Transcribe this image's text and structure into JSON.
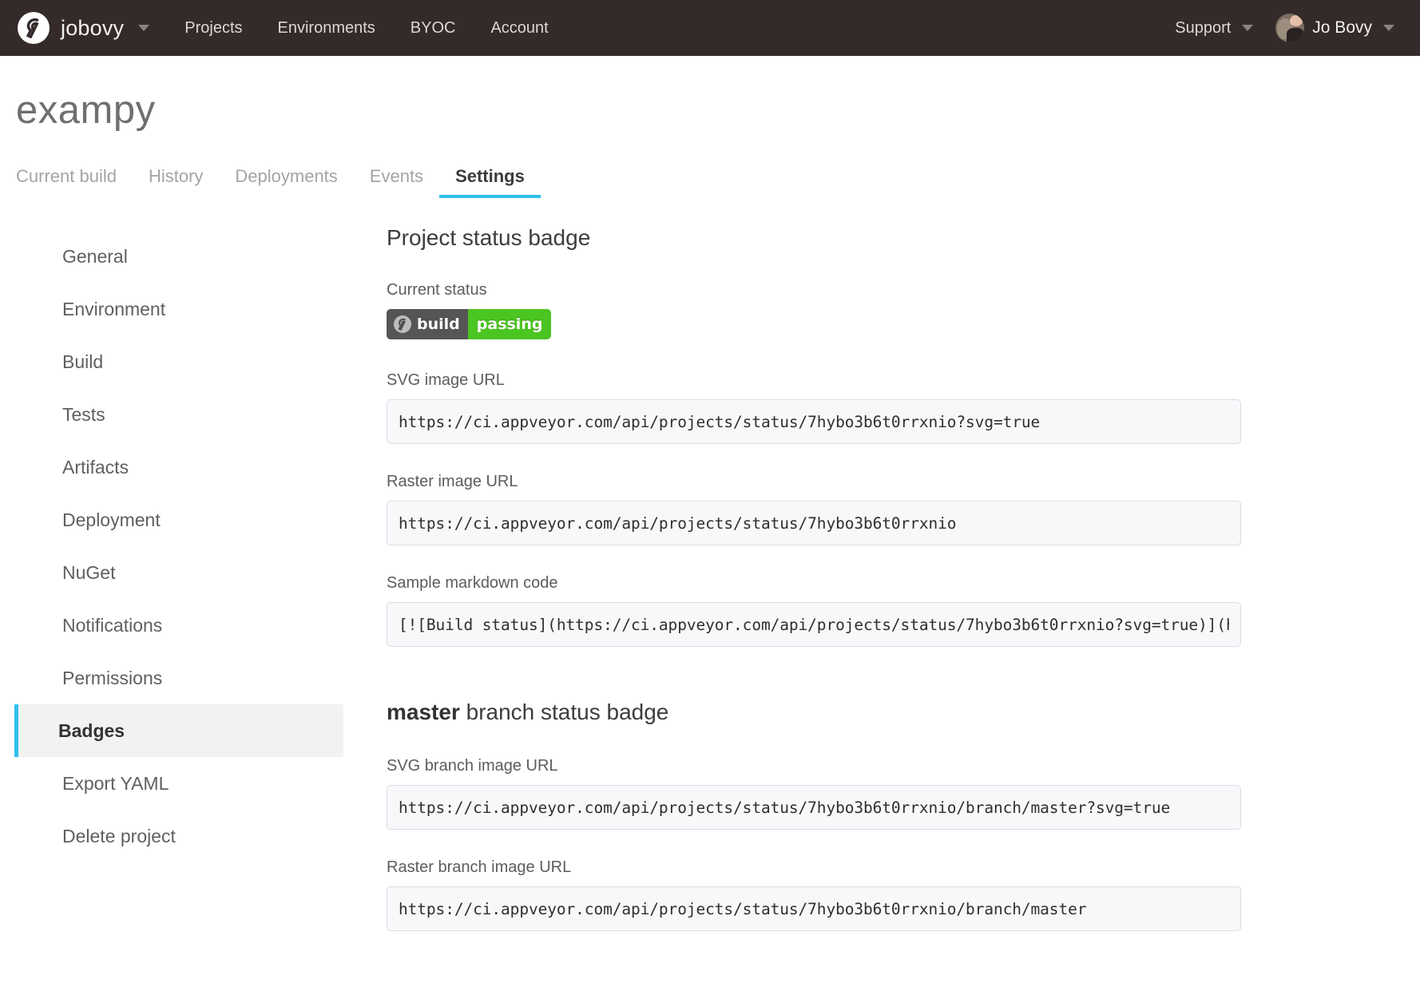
{
  "navbar": {
    "logo_icon": "appveyor-logo-icon",
    "account_name": "jobovy",
    "account_caret_icon": "chevron-down-icon",
    "links": [
      {
        "label": "Projects"
      },
      {
        "label": "Environments"
      },
      {
        "label": "BYOC"
      },
      {
        "label": "Account"
      }
    ],
    "support": {
      "label": "Support",
      "caret_icon": "chevron-down-icon"
    },
    "user": {
      "name": "Jo Bovy",
      "avatar_icon": "user-avatar",
      "caret_icon": "chevron-down-icon"
    },
    "colors": {
      "background": "#332a29",
      "text": "#f2f0ef"
    }
  },
  "page": {
    "project_title": "exampy",
    "tabs": [
      {
        "label": "Current build",
        "active": false
      },
      {
        "label": "History",
        "active": false
      },
      {
        "label": "Deployments",
        "active": false
      },
      {
        "label": "Events",
        "active": false
      },
      {
        "label": "Settings",
        "active": true
      }
    ],
    "accent_color": "#2ec0ee"
  },
  "sidebar": {
    "items": [
      {
        "label": "General",
        "active": false
      },
      {
        "label": "Environment",
        "active": false
      },
      {
        "label": "Build",
        "active": false
      },
      {
        "label": "Tests",
        "active": false
      },
      {
        "label": "Artifacts",
        "active": false
      },
      {
        "label": "Deployment",
        "active": false
      },
      {
        "label": "NuGet",
        "active": false
      },
      {
        "label": "Notifications",
        "active": false
      },
      {
        "label": "Permissions",
        "active": false
      },
      {
        "label": "Badges",
        "active": true
      },
      {
        "label": "Export YAML",
        "active": false
      },
      {
        "label": "Delete project",
        "active": false
      }
    ]
  },
  "main": {
    "project_badge": {
      "heading": "Project status badge",
      "current_status_label": "Current status",
      "badge": {
        "logo_icon": "appveyor-logo-icon",
        "left_text": "build",
        "right_text": "passing",
        "left_color": "#555555",
        "right_color": "#4bc521"
      },
      "fields": [
        {
          "label": "SVG image URL",
          "value": "https://ci.appveyor.com/api/projects/status/7hybo3b6t0rrxnio?svg=true"
        },
        {
          "label": "Raster image URL",
          "value": "https://ci.appveyor.com/api/projects/status/7hybo3b6t0rrxnio"
        },
        {
          "label": "Sample markdown code",
          "value": "[![Build status](https://ci.appveyor.com/api/projects/status/7hybo3b6t0rrxnio?svg=true)](https://ci.appveyor.com/project/jobovy/exampy)"
        }
      ]
    },
    "branch_badge": {
      "heading_bold": "master",
      "heading_rest": " branch status badge",
      "fields": [
        {
          "label": "SVG branch image URL",
          "value": "https://ci.appveyor.com/api/projects/status/7hybo3b6t0rrxnio/branch/master?svg=true"
        },
        {
          "label": "Raster branch image URL",
          "value": "https://ci.appveyor.com/api/projects/status/7hybo3b6t0rrxnio/branch/master"
        }
      ]
    }
  }
}
